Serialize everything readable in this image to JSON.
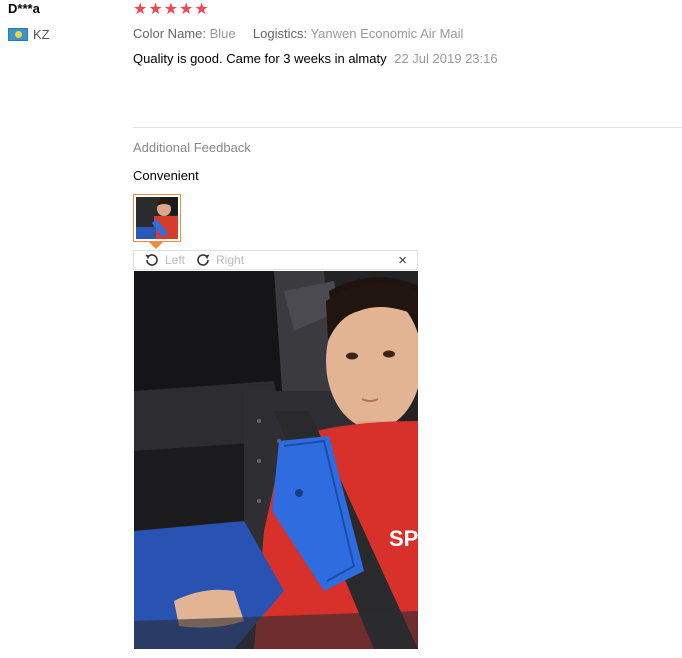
{
  "user": {
    "name": "D***a",
    "country": "KZ"
  },
  "review": {
    "rating": "★★★★★",
    "color_label": "Color Name:",
    "color_value": "Blue",
    "logistics_label": "Logistics:",
    "logistics_value": "Yanwen Economic Air Mail",
    "text": "Quality is good. Came for 3 weeks in almaty",
    "date": "22 Jul 2019 23:16"
  },
  "additional": {
    "title": "Additional Feedback",
    "text": "Convenient"
  },
  "viewer": {
    "left_label": "Left",
    "right_label": "Right",
    "close_label": "×"
  },
  "colors": {
    "stars": "#f0484d",
    "thumb_border": "#f08a3c",
    "flag": "#3b95c8"
  }
}
